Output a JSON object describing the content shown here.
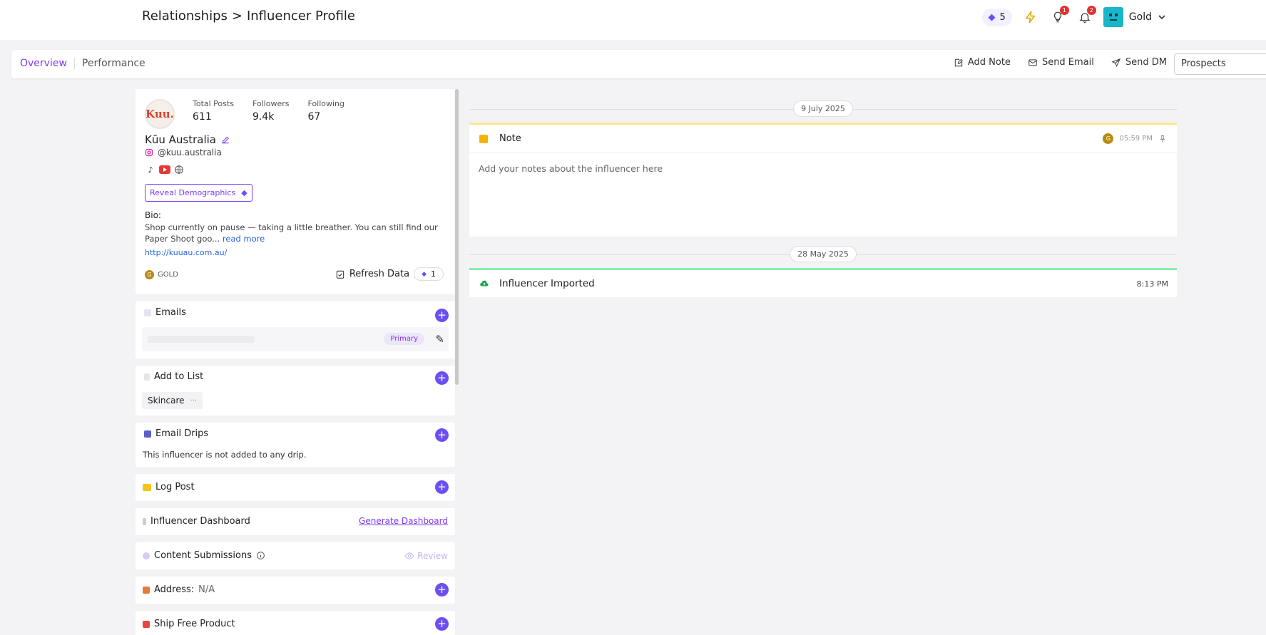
{
  "breadcrumb": {
    "parent": "Relationships",
    "sep": ">",
    "current": "Influencer Profile"
  },
  "topbar": {
    "credits": "5",
    "ideas_badge": "1",
    "notif_badge": "2",
    "user_label": "Gold"
  },
  "tabs": [
    {
      "label": "Overview"
    },
    {
      "label": "Performance"
    }
  ],
  "actions": {
    "add_note": "Add Note",
    "send_email": "Send Email",
    "send_dm": "Send DM",
    "stage_select": "Prospects"
  },
  "profile": {
    "avatar_text": "Kuu.",
    "stats": [
      {
        "label": "Total Posts",
        "value": "611"
      },
      {
        "label": "Followers",
        "value": "9.4k"
      },
      {
        "label": "Following",
        "value": "67"
      }
    ],
    "name": "Kūu Australia",
    "handle": "@kuu.australia",
    "reveal_label": "Reveal Demographics",
    "bio_heading": "Bio:",
    "bio_text": "Shop currently on pause — taking a little breather. You can still find our Paper Shoot goo...",
    "read_more": "read more",
    "website": "http://kuuau.com.au/",
    "tier": "GOLD",
    "tier_coin": "G",
    "refresh_label": "Refresh Data",
    "refresh_cost": "1"
  },
  "sections": {
    "emails": {
      "title": "Emails",
      "primary_badge": "Primary"
    },
    "add_to_list": {
      "title": "Add to List",
      "chip": "Skincare",
      "chip_more": "···"
    },
    "email_drips": {
      "title": "Email Drips",
      "message": "This influencer is not added to any drip."
    },
    "log_post": {
      "title": "Log Post"
    },
    "dashboard": {
      "title": "Influencer Dashboard",
      "link": "Generate Dashboard"
    },
    "content": {
      "title": "Content Submissions",
      "review": "Review"
    },
    "address": {
      "title": "Address:",
      "value": "N/A"
    },
    "ship": {
      "title": "Ship Free Product"
    }
  },
  "timeline": {
    "date1": "9 July 2025",
    "note_title": "Note",
    "note_time": "05:59 PM",
    "note_user": "G",
    "note_placeholder": "Add your notes about the influencer here",
    "date2": "28 May 2025",
    "import_title": "Influencer Imported",
    "import_time": "8:13 PM"
  },
  "colors": {
    "accent": "#7c3aed",
    "plus": "#6d4ef2",
    "note_border": "#fde68a",
    "import_border": "#86efac"
  }
}
